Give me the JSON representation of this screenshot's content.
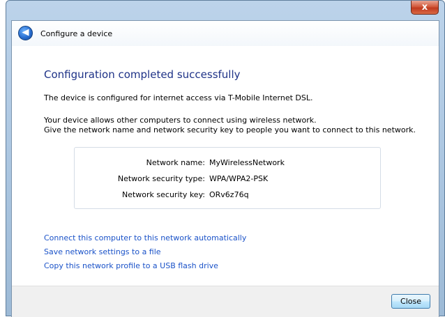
{
  "window": {
    "close_glyph": "x"
  },
  "nav": {
    "title": "Configure a device",
    "back_glyph": "◀"
  },
  "main": {
    "heading": "Configuration completed successfully",
    "status_line": "The device is configured for internet access via T-Mobile Internet DSL.",
    "info_line1": "Your device allows other computers to connect using wireless network.",
    "info_line2": "Give the network name and network security key to people you want to connect to this network."
  },
  "network": {
    "name_label": "Network name:",
    "name_value": "MyWirelessNetwork",
    "type_label": "Network security type:",
    "type_value": "WPA/WPA2-PSK",
    "key_label": "Network security key:",
    "key_value": "ORv6z76q"
  },
  "links": [
    "Connect this computer to this network automatically",
    "Save network settings to a file",
    "Copy this network profile to a USB flash drive"
  ],
  "footer": {
    "close_label": "Close"
  },
  "colors": {
    "heading": "#1e3287",
    "link": "#1a52c8",
    "titlebar": "#bcd3ea"
  }
}
